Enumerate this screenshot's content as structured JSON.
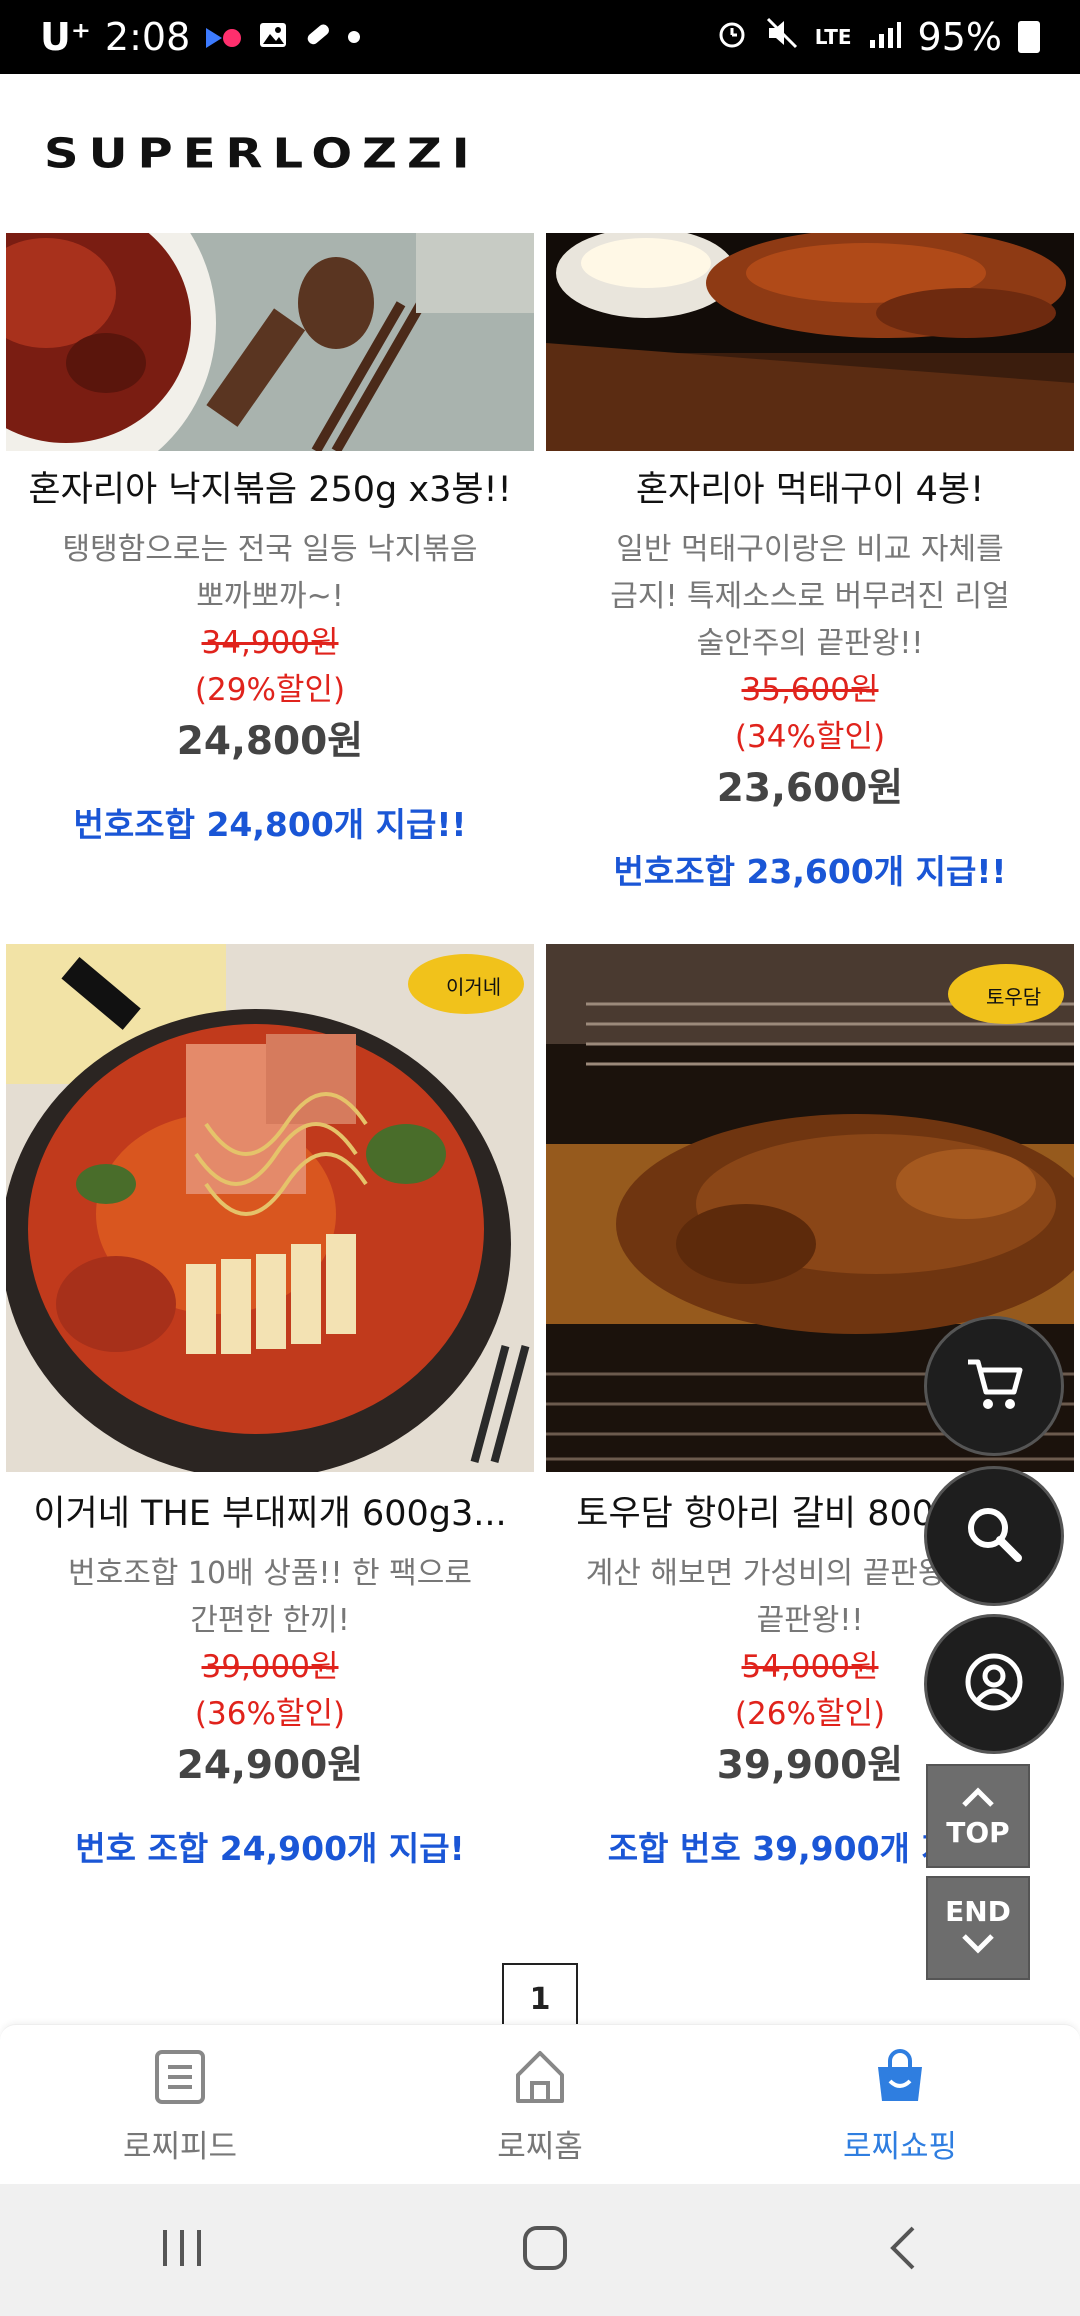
{
  "status_bar": {
    "carrier": "U⁺",
    "time": "2:08",
    "battery": "95%",
    "network": "LTE"
  },
  "header": {
    "logo": "SUPERLOZZI"
  },
  "products": [
    {
      "title": "혼자리아 낙지볶음 250g x3봉!!",
      "desc_lines": [
        "탱탱함으로는 전국 일등 낙지볶음",
        "뽀까뽀까~!"
      ],
      "original_price": "34,900원",
      "discount": "(29%할인)",
      "price": "24,800원",
      "promo": "번호조합 24,800개 지급!!"
    },
    {
      "title": "혼자리아 먹태구이 4봉!",
      "desc_lines": [
        "일반 먹태구이랑은 비교 자체를",
        "금지! 특제소스로 버무려진 리얼",
        "술안주의 끝판왕!!"
      ],
      "original_price": "35,600원",
      "discount": "(34%할인)",
      "price": "23,600원",
      "promo": "번호조합 23,600개 지급!!"
    },
    {
      "title": "이거네 THE 부대찌개 600g3...",
      "desc_lines": [
        "번호조합 10배 상품!! 한 팩으로",
        "간편한 한끼!"
      ],
      "original_price": "39,000원",
      "discount": "(36%할인)",
      "price": "24,900원",
      "promo": "번호 조합 24,900개 지급!"
    },
    {
      "title": "토우담 항아리 갈비 800g x3...",
      "desc_lines": [
        "계산 해보면 가성비의 끝판왕!! 맛도",
        "끝판왕!!"
      ],
      "original_price": "54,000원",
      "discount": "(26%할인)",
      "price": "39,900원",
      "promo": "조합 번호 39,900개 지급!!"
    }
  ],
  "floating": {
    "top_label": "TOP",
    "end_label": "END",
    "icons": [
      "cart-icon",
      "search-icon",
      "user-icon"
    ]
  },
  "pagination": {
    "current_page": "1"
  },
  "bottom_nav": [
    {
      "label": "로찌피드",
      "icon": "feed-icon"
    },
    {
      "label": "로찌홈",
      "icon": "home-icon"
    },
    {
      "label": "로찌쇼핑",
      "icon": "shopping-bag-icon",
      "active": true
    }
  ],
  "colors": {
    "accent_blue": "#1a56d6",
    "nav_active": "#2f7ee0",
    "sale_red": "#e0231c"
  }
}
